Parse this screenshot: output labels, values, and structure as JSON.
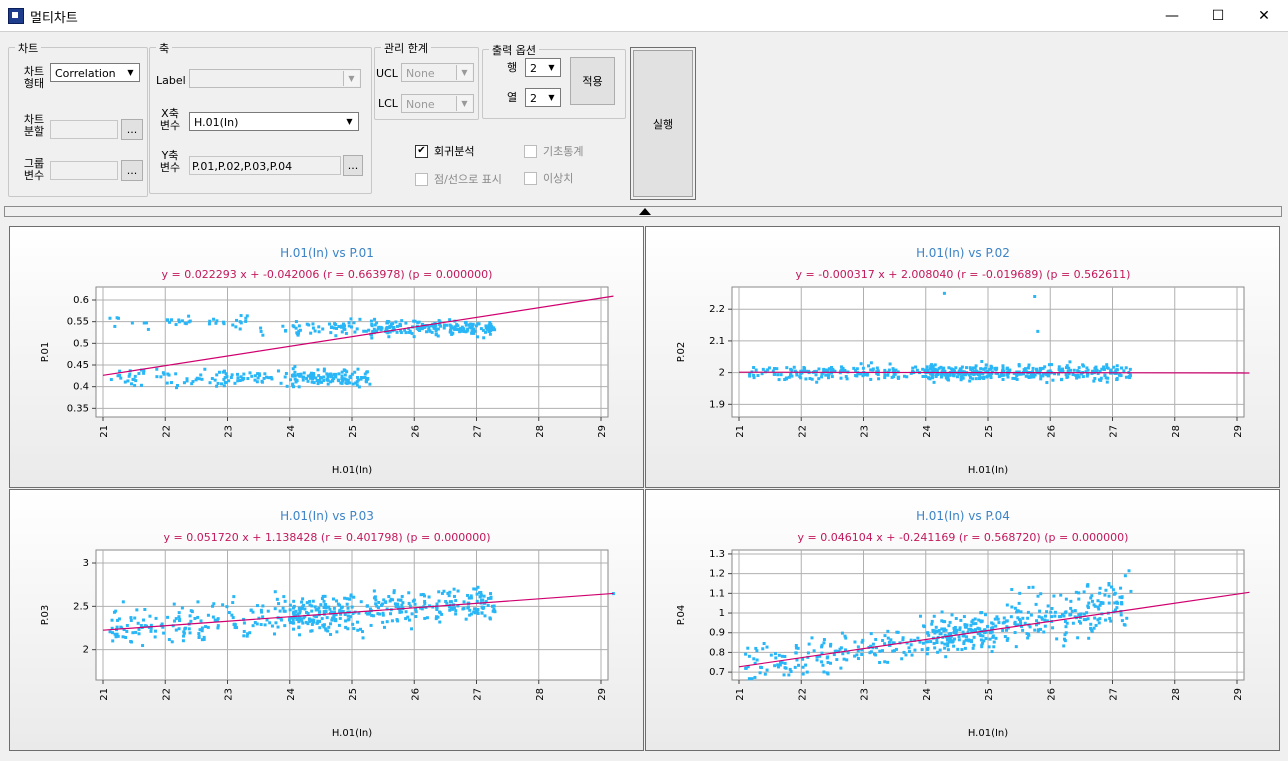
{
  "window": {
    "title": "멀티차트",
    "minimize": "—",
    "maximize": "☐",
    "close": "✕"
  },
  "chart_group": {
    "title": "차트",
    "type_label": "차트\n형태",
    "type_value": "Correlation",
    "split_label": "차트\n분할",
    "group_label": "그룹\n변수",
    "browse": "..."
  },
  "axis_group": {
    "title": "축",
    "label_label": "Label",
    "x_label": "X축\n변수",
    "x_value": "H.01(In)",
    "y_label": "Y축\n변수",
    "y_value": "P.01,P.02,P.03,P.04",
    "browse": "..."
  },
  "limit_group": {
    "title": "관리 한계",
    "ucl_label": "UCL",
    "ucl_value": "None",
    "lcl_label": "LCL",
    "lcl_value": "None"
  },
  "output_group": {
    "title": "출력 옵션",
    "row_label": "행",
    "row_value": "2",
    "col_label": "열",
    "col_value": "2",
    "apply": "적용"
  },
  "options": {
    "regression": "회귀분석",
    "regression_checked": true,
    "basic_stats": "기초통계",
    "points_lines": "점/선으로 표시",
    "outliers": "이상치"
  },
  "run": "실행",
  "colors": {
    "point": "#29b6f6",
    "line": "#d0006f",
    "title": "#3d84c6",
    "eq": "#c2185b",
    "grid": "#b0b0b0"
  },
  "chart_data": [
    {
      "type": "scatter",
      "title": "H.01(In)   vs   P.01",
      "subtitle": "y = 0.022293 x + -0.042006  (r = 0.663978) (p = 0.000000)",
      "xlabel": "H.01(In)",
      "ylabel": "P.01",
      "xlim": [
        21,
        29
      ],
      "ylim": [
        0.33,
        0.63
      ],
      "xticks": [
        "21",
        "22",
        "23",
        "24",
        "25",
        "26",
        "27",
        "28",
        "29"
      ],
      "yticks": [
        "0.35",
        "0.4",
        "0.45",
        "0.5",
        "0.55",
        "0.6"
      ],
      "ytick_values": [
        0.35,
        0.4,
        0.45,
        0.5,
        0.55,
        0.6
      ],
      "slope": 0.022293,
      "intercept": -0.042006,
      "line_x": [
        21.0,
        29.2
      ]
    },
    {
      "type": "scatter",
      "title": "H.01(In)   vs   P.02",
      "subtitle": "y = -0.000317 x + 2.008040  (r = -0.019689) (p = 0.562611)",
      "xlabel": "H.01(In)",
      "ylabel": "P.02",
      "xlim": [
        21,
        29
      ],
      "ylim": [
        1.86,
        2.27
      ],
      "xticks": [
        "21",
        "22",
        "23",
        "24",
        "25",
        "26",
        "27",
        "28",
        "29"
      ],
      "yticks": [
        "1.9",
        "2",
        "2.1",
        "2.2"
      ],
      "ytick_values": [
        1.9,
        2.0,
        2.1,
        2.2
      ],
      "slope": -0.000317,
      "intercept": 2.00804,
      "line_x": [
        21.0,
        29.2
      ]
    },
    {
      "type": "scatter",
      "title": "H.01(In)   vs   P.03",
      "subtitle": "y = 0.051720 x + 1.138428  (r = 0.401798) (p = 0.000000)",
      "xlabel": "H.01(In)",
      "ylabel": "P.03",
      "xlim": [
        21,
        29
      ],
      "ylim": [
        1.65,
        3.15
      ],
      "xticks": [
        "21",
        "22",
        "23",
        "24",
        "25",
        "26",
        "27",
        "28",
        "29"
      ],
      "yticks": [
        "2",
        "2.5",
        "3"
      ],
      "ytick_values": [
        2.0,
        2.5,
        3.0
      ],
      "slope": 0.05172,
      "intercept": 1.138428,
      "line_x": [
        21.0,
        29.2
      ]
    },
    {
      "type": "scatter",
      "title": "H.01(In)   vs   P.04",
      "subtitle": "y = 0.046104 x + -0.241169  (r = 0.568720) (p = 0.000000)",
      "xlabel": "H.01(In)",
      "ylabel": "P.04",
      "xlim": [
        21,
        29
      ],
      "ylim": [
        0.66,
        1.32
      ],
      "xticks": [
        "21",
        "22",
        "23",
        "24",
        "25",
        "26",
        "27",
        "28",
        "29"
      ],
      "yticks": [
        "0.7",
        "0.8",
        "0.9",
        "1",
        "1.1",
        "1.2",
        "1.3"
      ],
      "ytick_values": [
        0.7,
        0.8,
        0.9,
        1.0,
        1.1,
        1.2,
        1.3
      ],
      "slope": 0.046104,
      "intercept": -0.241169,
      "line_x": [
        21.0,
        29.2
      ]
    }
  ]
}
